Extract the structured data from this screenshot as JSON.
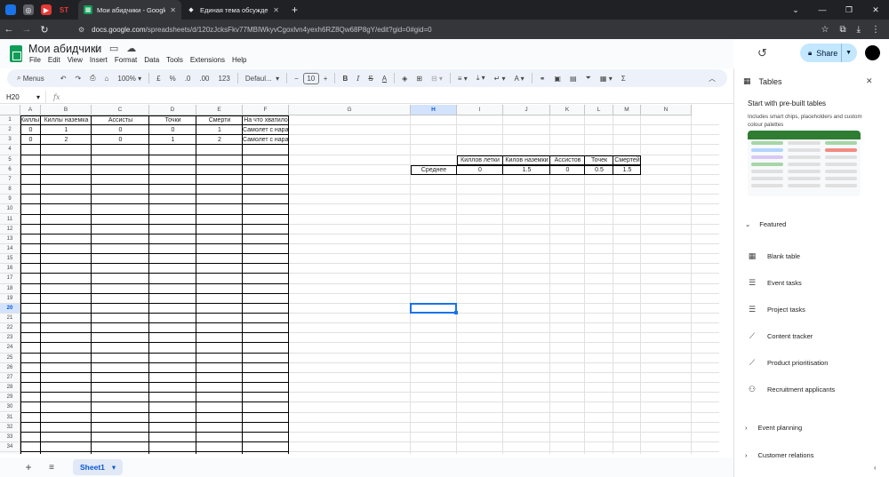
{
  "browser": {
    "tabs": [
      {
        "title": "Мои абидчики - Google Sheets",
        "active": true
      },
      {
        "title": "Единая тема обсуждения бал...",
        "active": false
      }
    ],
    "url_prefix": "docs.google.com",
    "url_path": "/spreadsheets/d/120zJcksFkv77MBIWkyvCgoxlvn4yexh6RZ8Qw68P8gY/edit?gid=0#gid=0"
  },
  "app": {
    "title": "Мои абидчики",
    "menus": [
      "File",
      "Edit",
      "View",
      "Insert",
      "Format",
      "Data",
      "Tools",
      "Extensions",
      "Help"
    ],
    "share_label": "Share"
  },
  "toolbar": {
    "menus_label": "Menus",
    "zoom": "100%",
    "currency": "£",
    "percent": "%",
    "dec_less": ".0",
    "dec_more": ".00",
    "number_format": "123",
    "font": "Defaul...",
    "font_size": "10"
  },
  "formula_bar": {
    "name_box": "H20",
    "fx": "fx"
  },
  "grid": {
    "columns": [
      "A",
      "B",
      "C",
      "D",
      "E",
      "F",
      "G",
      "H",
      "I",
      "J",
      "K",
      "L",
      "M",
      "N"
    ],
    "selected_column": "H",
    "selected_row": 20,
    "row_count": 35,
    "cells": [
      {
        "ref": "A1",
        "col": 0,
        "row": 1,
        "v": "Киллы летка"
      },
      {
        "ref": "B1",
        "col": 1,
        "row": 1,
        "v": "Киллы наземка"
      },
      {
        "ref": "C1",
        "col": 2,
        "row": 1,
        "v": "Ассисты"
      },
      {
        "ref": "D1",
        "col": 3,
        "row": 1,
        "v": "Точки"
      },
      {
        "ref": "E1",
        "col": 4,
        "row": 1,
        "v": "Смерти"
      },
      {
        "ref": "F1",
        "col": 5,
        "row": 1,
        "v": "На что хватило"
      },
      {
        "ref": "A2",
        "col": 0,
        "row": 2,
        "v": "0"
      },
      {
        "ref": "B2",
        "col": 1,
        "row": 2,
        "v": "1"
      },
      {
        "ref": "C2",
        "col": 2,
        "row": 2,
        "v": "0"
      },
      {
        "ref": "D2",
        "col": 3,
        "row": 2,
        "v": "0"
      },
      {
        "ref": "E2",
        "col": 4,
        "row": 2,
        "v": "1"
      },
      {
        "ref": "F2",
        "col": 5,
        "row": 2,
        "v": "Самолет с нарами"
      },
      {
        "ref": "A3",
        "col": 0,
        "row": 3,
        "v": "0"
      },
      {
        "ref": "B3",
        "col": 1,
        "row": 3,
        "v": "2"
      },
      {
        "ref": "C3",
        "col": 2,
        "row": 3,
        "v": "0"
      },
      {
        "ref": "D3",
        "col": 3,
        "row": 3,
        "v": "1"
      },
      {
        "ref": "E3",
        "col": 4,
        "row": 3,
        "v": "2"
      },
      {
        "ref": "F3",
        "col": 5,
        "row": 3,
        "v": "Самолет с нарами и бомбами"
      },
      {
        "ref": "I5",
        "col": 8,
        "row": 5,
        "v": "Киллов летки"
      },
      {
        "ref": "J5",
        "col": 9,
        "row": 5,
        "v": "Килов наземки"
      },
      {
        "ref": "K5",
        "col": 10,
        "row": 5,
        "v": "Ассистов"
      },
      {
        "ref": "L5",
        "col": 11,
        "row": 5,
        "v": "Точек"
      },
      {
        "ref": "M5",
        "col": 12,
        "row": 5,
        "v": "Смертей"
      },
      {
        "ref": "H6",
        "col": 7,
        "row": 6,
        "v": "Среднее"
      },
      {
        "ref": "I6",
        "col": 8,
        "row": 6,
        "v": "0"
      },
      {
        "ref": "J6",
        "col": 9,
        "row": 6,
        "v": "1.5"
      },
      {
        "ref": "K6",
        "col": 10,
        "row": 6,
        "v": "0"
      },
      {
        "ref": "L6",
        "col": 11,
        "row": 6,
        "v": "0.5"
      },
      {
        "ref": "M6",
        "col": 12,
        "row": 6,
        "v": "1.5"
      }
    ]
  },
  "sheets": {
    "active": "Sheet1"
  },
  "panel": {
    "title": "Tables",
    "prebuilt_title": "Start with pre-built tables",
    "prebuilt_desc": "Includes smart chips, placeholders and custom colour palettes",
    "featured_label": "Featured",
    "items": [
      {
        "label": "Blank table",
        "icon": "table-icon"
      },
      {
        "label": "Event tasks",
        "icon": "checklist-icon"
      },
      {
        "label": "Project tasks",
        "icon": "checklist-icon"
      },
      {
        "label": "Content tracker",
        "icon": "trend-icon"
      },
      {
        "label": "Product prioritisation",
        "icon": "trend-icon"
      },
      {
        "label": "Recruitment applicants",
        "icon": "person-icon"
      }
    ],
    "collapsed": [
      "Event planning",
      "Customer relations"
    ]
  }
}
